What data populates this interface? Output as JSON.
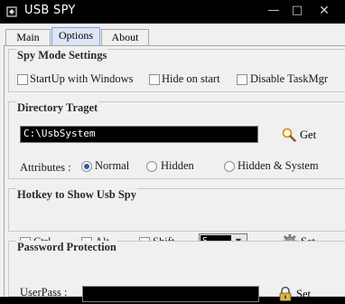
{
  "window": {
    "title": "USB SPY"
  },
  "tabs": [
    "Main",
    "Options",
    "About"
  ],
  "spy_mode": {
    "title": "Spy Mode Settings",
    "startup": "StartUp with Windows",
    "hide_on_start": "Hide on start",
    "disable_taskmgr": "Disable TaskMgr"
  },
  "directory": {
    "title": "Directory Traget",
    "path": "C:\\UsbSystem",
    "get_label": "Get",
    "attributes_label": "Attributes :",
    "options": [
      "Normal",
      "Hidden",
      "Hidden & System"
    ],
    "selected": "Normal"
  },
  "hotkey": {
    "title": "Hotkey to Show Usb Spy",
    "ctrl": "Ctrl",
    "alt": "Alt",
    "shift": "Shift",
    "key": "S",
    "set_label": "Set"
  },
  "password": {
    "title": "Password Protection",
    "userpass_label": "UserPass :",
    "set_label": "Set"
  }
}
